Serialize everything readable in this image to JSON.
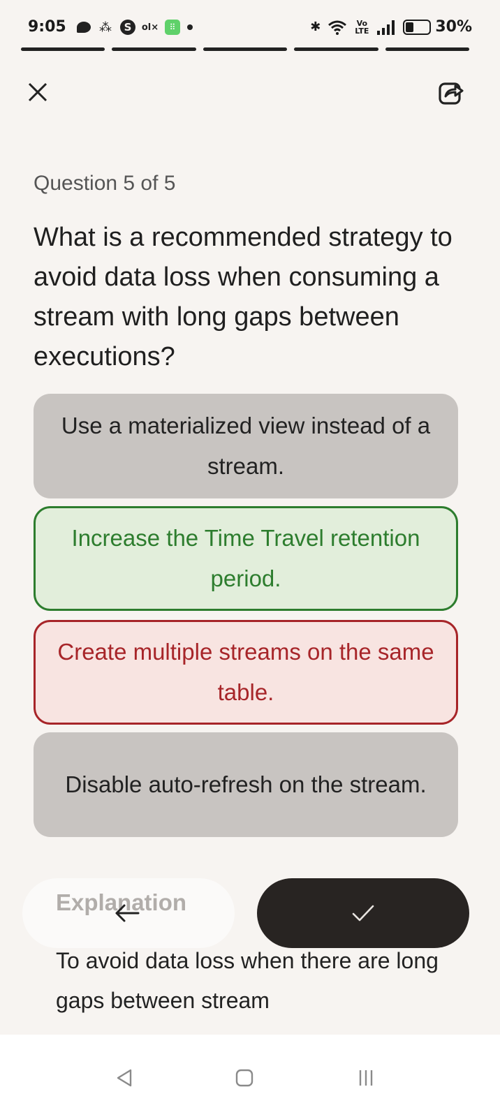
{
  "status_bar": {
    "time": "9:05",
    "battery_percent_label": "30%",
    "battery_level": 0.3,
    "network_label": "Vo LTE",
    "notification_icons": [
      "message-icon",
      "people-icon",
      "app-s-icon",
      "olx-icon",
      "green-app-icon",
      "dot-icon"
    ],
    "system_icons": [
      "bluetooth-icon",
      "wifi-icon",
      "volte-icon",
      "signal-icon",
      "battery-icon"
    ]
  },
  "progress": {
    "total_segments": 5,
    "completed_segments": 5
  },
  "header": {
    "close_icon": "close-icon",
    "share_icon": "share-icon"
  },
  "question": {
    "counter": "Question 5 of 5",
    "text": "What is a recommended strategy to avoid data loss when consuming a stream with long gaps between executions?"
  },
  "options": [
    {
      "label": "Use a materialized view instead of a stream.",
      "state": "neutral"
    },
    {
      "label": "Increase the Time Travel retention period.",
      "state": "correct"
    },
    {
      "label": "Create multiple streams on the same table.",
      "state": "incorrect"
    },
    {
      "label": "Disable auto-refresh on the stream.",
      "state": "neutral"
    }
  ],
  "explanation": {
    "title": "Explanation",
    "text": "To avoid data loss when there are long gaps between stream"
  },
  "actions": {
    "back_icon": "arrow-left-icon",
    "confirm_icon": "checkmark-icon"
  },
  "colors": {
    "background": "#f7f4f1",
    "correct": "#2d7d2e",
    "correct_bg": "#e2eedb",
    "incorrect": "#a72529",
    "incorrect_bg": "#f8e4e1",
    "neutral_bg": "#c8c4c1",
    "confirm_bg": "#282422"
  }
}
